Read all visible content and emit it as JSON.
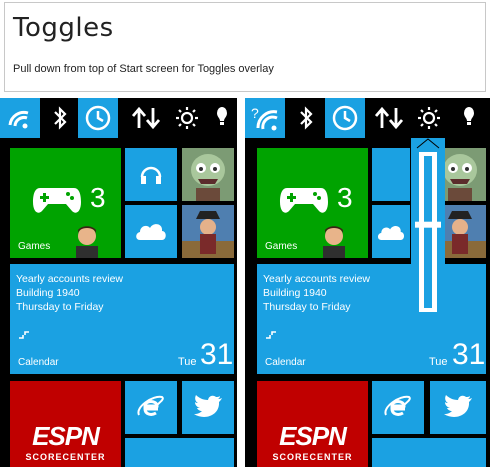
{
  "header": {
    "title": "Toggles",
    "instruction": "Pull down from top of Start screen for Toggles overlay"
  },
  "toggles": [
    {
      "icon": "wifi-icon",
      "state": "on"
    },
    {
      "icon": "bluetooth-icon",
      "state": "off"
    },
    {
      "icon": "rotation-lock-icon",
      "state": "on"
    },
    {
      "icon": "cellular-data-icon",
      "state": "off"
    },
    {
      "icon": "brightness-icon",
      "state": "off"
    },
    {
      "icon": "flashlight-icon",
      "state": "off"
    }
  ],
  "tiles": {
    "games": {
      "label": "Games",
      "count": "3",
      "color": "#00a300"
    },
    "music": {
      "icon": "headphones-icon"
    },
    "game_art": {
      "icon": "zombie-game-icon"
    },
    "onedrive": {
      "icon": "cloud-icon"
    },
    "pirate_game": {
      "icon": "pirate-game-icon"
    },
    "calendar": {
      "event_title": "Yearly accounts review",
      "location": "Building 1940",
      "when": "Thursday to Friday",
      "label": "Calendar",
      "weekday": "Tue",
      "date": "31",
      "color": "#1ba1e2"
    },
    "espn": {
      "logo": "ESPN",
      "subtitle": "SCORECENTER",
      "color": "#c00000"
    },
    "ie": {
      "icon": "internet-explorer-icon"
    },
    "twitter": {
      "icon": "twitter-bird-icon"
    }
  },
  "brightness_slider": {
    "level": 0.55
  },
  "colors": {
    "accent": "#1ba1e2",
    "games": "#00a300",
    "espn": "#c00000"
  }
}
